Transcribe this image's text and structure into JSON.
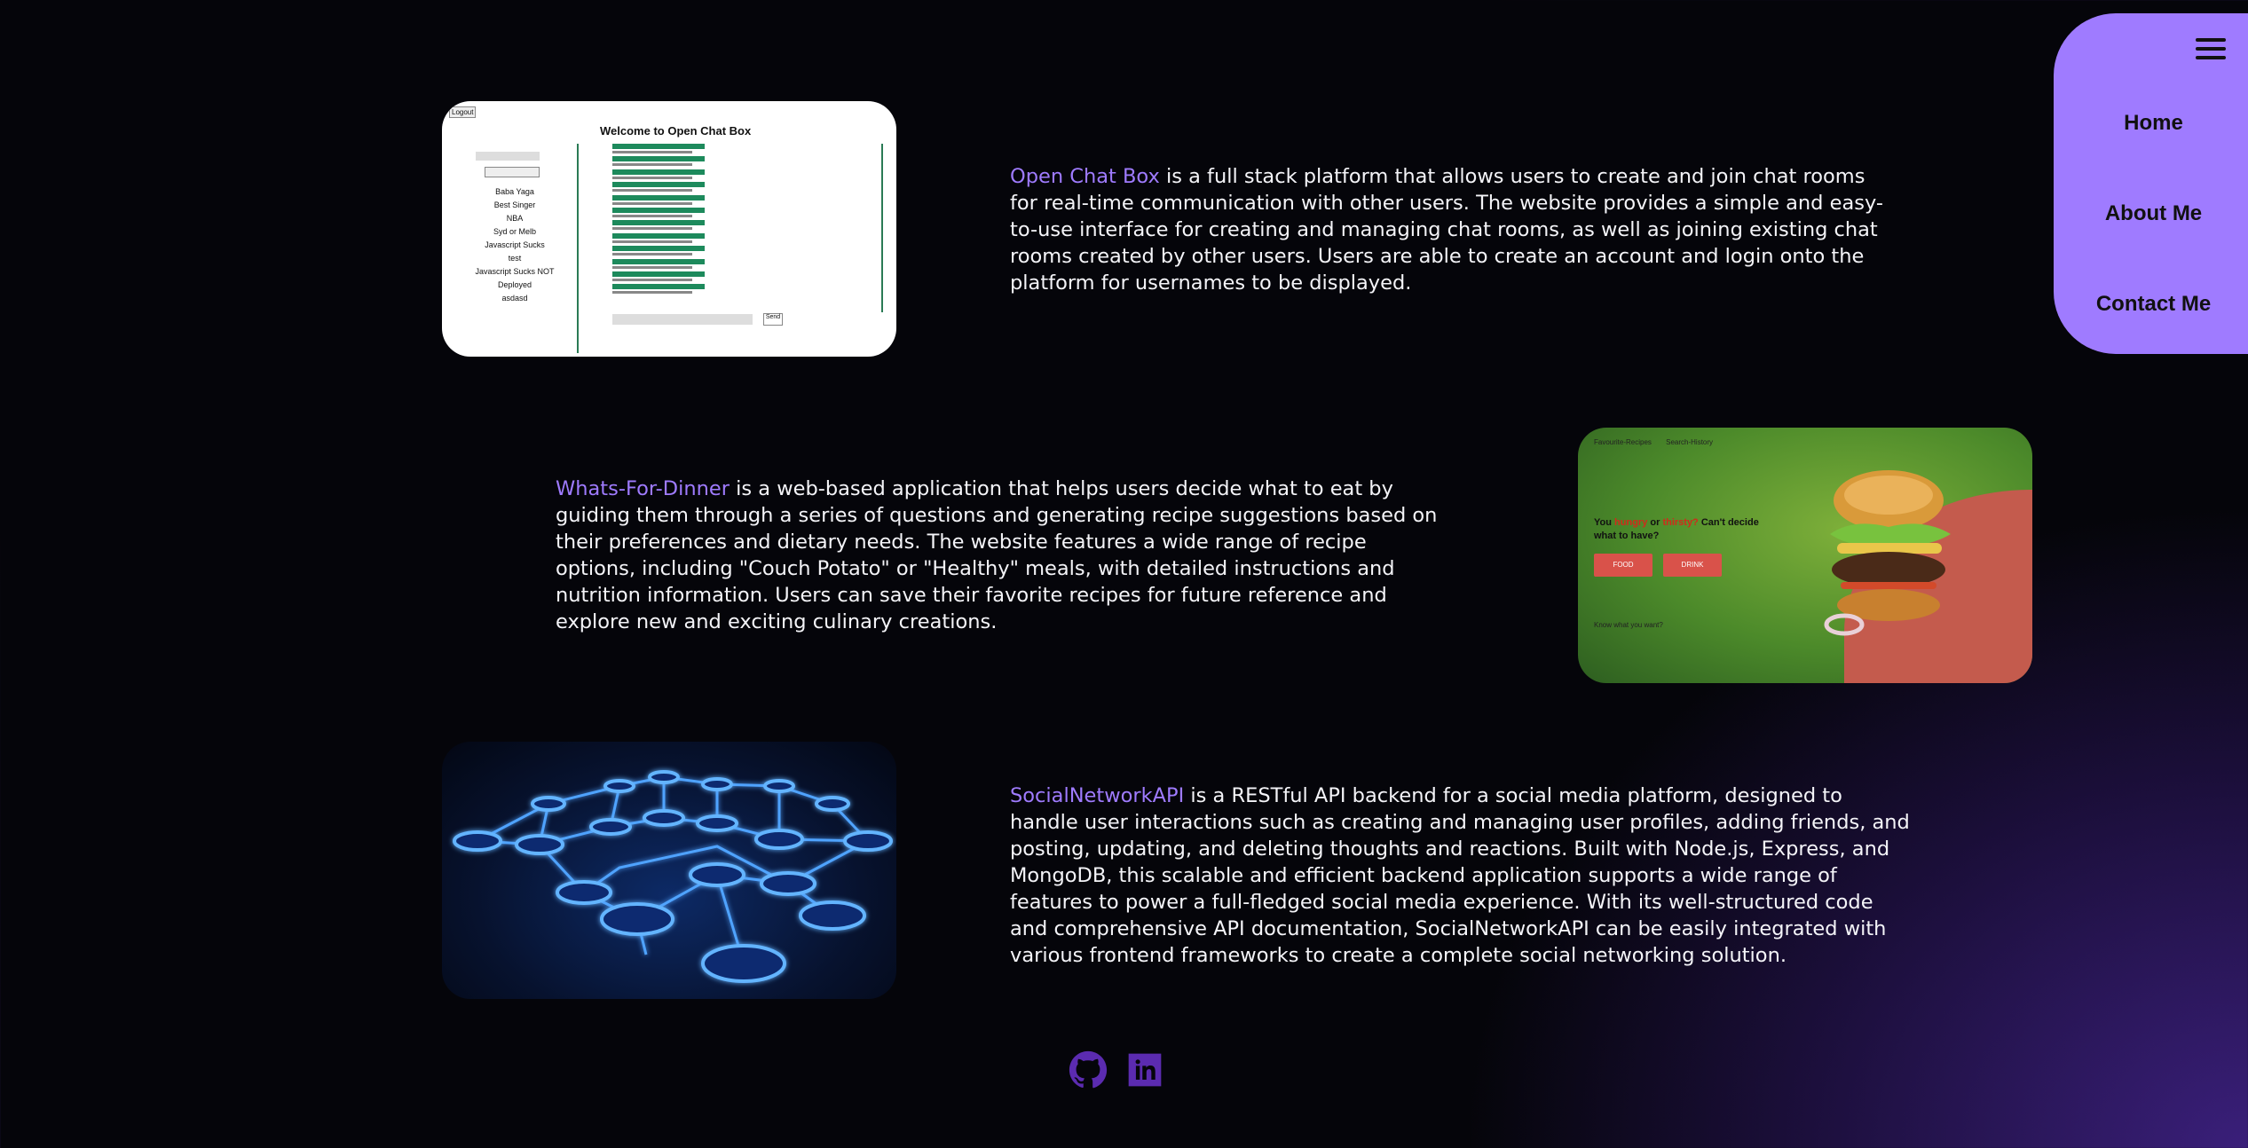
{
  "nav": {
    "menu_icon": "hamburger-menu-icon",
    "items": [
      {
        "label": "Home"
      },
      {
        "label": "About Me"
      },
      {
        "label": "Contact Me"
      }
    ]
  },
  "projects": [
    {
      "title": "Open Chat Box",
      "description": " is a full stack platform that allows users to create and join chat rooms for real-time communication with other users. The website provides a simple and easy-to-use interface for creating and managing chat rooms, as well as joining existing chat rooms created by other users. Users are able to create an account and login onto the platform for usernames to be displayed.",
      "screenshot": {
        "logout": "Logout",
        "heading": "Welcome to Open Chat Box",
        "rooms": [
          "Baba Yaga",
          "Best Singer",
          "NBA",
          "Syd or Melb",
          "Javascript Sucks",
          "test",
          "Javascript Sucks NOT",
          "Deployed",
          "asdasd"
        ],
        "send": "Send"
      }
    },
    {
      "title": "Whats-For-Dinner",
      "description": " is a web-based application that helps users decide what to eat by guiding them through a series of questions and generating recipe suggestions based on their preferences and dietary needs. The website features a wide range of recipe options, including \"Couch Potato\" or \"Healthy\" meals, with detailed instructions and nutrition information. Users can save their favorite recipes for future reference and explore new and exciting culinary creations.",
      "screenshot": {
        "nav_links": "Favourite-Recipes Search-History",
        "q_you": "You",
        "q_hungry": "hungry",
        "q_or": "or",
        "q_thirsty": "thirsty?",
        "q_rest": "Can't decide what to have?",
        "food_button": "FOOD",
        "drink_button": "DRINK",
        "know_text": "Know what you want?"
      }
    },
    {
      "title": "SocialNetworkAPI",
      "description": " is a RESTful API backend for a social media platform, designed to handle user interactions such as creating and managing user profiles, adding friends, and posting, updating, and deleting thoughts and reactions. Built with Node.js, Express, and MongoDB, this scalable and efficient backend application supports a wide range of features to power a full-fledged social media experience. With its well-structured code and comprehensive API documentation, SocialNetworkAPI can be easily integrated with various frontend frameworks to create a complete social networking solution."
    }
  ],
  "footer": {
    "icons": [
      "github-icon",
      "linkedin-icon"
    ]
  },
  "colors": {
    "accent": "#9f7bff",
    "background": "#05050a",
    "social_icon": "#5b2bb0"
  }
}
